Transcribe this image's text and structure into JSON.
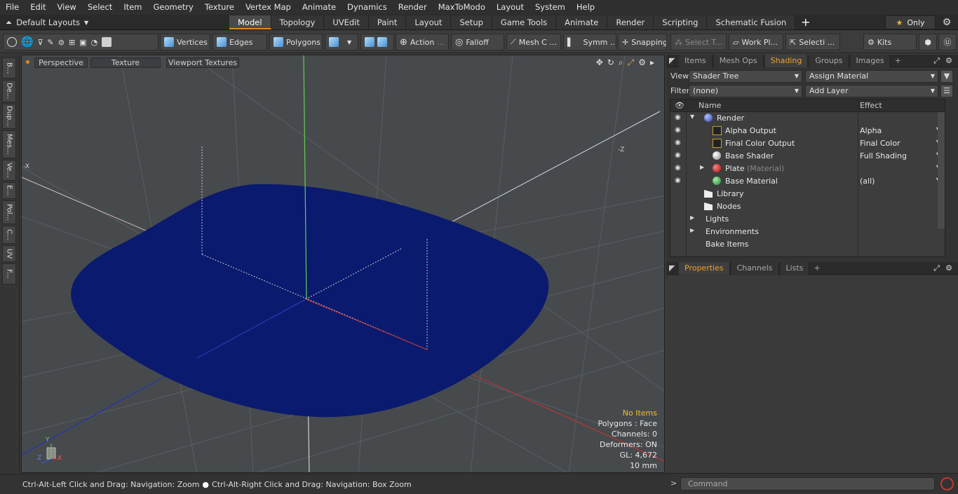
{
  "menu": [
    "File",
    "Edit",
    "View",
    "Select",
    "Item",
    "Geometry",
    "Texture",
    "Vertex Map",
    "Animate",
    "Dynamics",
    "Render",
    "MaxToModo",
    "Layout",
    "System",
    "Help"
  ],
  "layout_selector": "Default Layouts",
  "mode_tabs": [
    {
      "label": "Model",
      "active": true
    },
    {
      "label": "Topology"
    },
    {
      "label": "UVEdit"
    },
    {
      "label": "Paint"
    },
    {
      "label": "Layout"
    },
    {
      "label": "Setup"
    },
    {
      "label": "Game Tools"
    },
    {
      "label": "Animate"
    },
    {
      "label": "Render"
    },
    {
      "label": "Scripting"
    },
    {
      "label": "Schematic Fusion"
    }
  ],
  "only_label": "Only",
  "toolbar": {
    "vertices": "Vertices",
    "edges": "Edges",
    "polygons": "Polygons",
    "action": "Action",
    "falloff": "Falloff",
    "mesh": "Mesh C ...",
    "symm": "Symm ...",
    "snapping": "Snapping",
    "select_t": "Select T...",
    "work_pl": "Work Pl...",
    "selecti": "Selecti ...",
    "kits": "Kits"
  },
  "left_tabs": [
    "B...",
    "De...",
    "Dup...",
    "Mes...",
    "Ve...",
    "E...",
    "Pol...",
    "C...",
    "UV",
    "F..."
  ],
  "viewport": {
    "perspective": "Perspective",
    "texture": "Texture",
    "viewport_textures": "Viewport Textures",
    "axis_minus_z": "-Z",
    "axis_minus_x": "-X",
    "hud": [
      "No Items",
      "Polygons : Face",
      "Channels: 0",
      "Deformers: ON",
      "GL: 4,672",
      "10 mm"
    ],
    "colors": {
      "object": "#0a1a6e",
      "background": "#464a4d"
    }
  },
  "statusbar": {
    "left": "Ctrl-Alt-Left Click and Drag: Navigation: Zoom",
    "right": "Ctrl-Alt-Right Click and Drag: Navigation: Box Zoom"
  },
  "right_panel": {
    "tabs": [
      "Items",
      "Mesh Ops",
      "Shading",
      "Groups",
      "Images"
    ],
    "active_tab": "Shading",
    "view_label": "View",
    "view_value": "Shader Tree",
    "assign_material": "Assign Material",
    "filter_label": "Filter",
    "filter_value": "(none)",
    "add_layer": "Add Layer",
    "col_name": "Name",
    "col_effect": "Effect",
    "tree": [
      {
        "name": "Render",
        "effect": "",
        "indent": 0,
        "icon": "render-ball"
      },
      {
        "name": "Alpha Output",
        "effect": "Alpha",
        "indent": 1,
        "icon": "output"
      },
      {
        "name": "Final Color Output",
        "effect": "Final Color",
        "indent": 1,
        "icon": "output"
      },
      {
        "name": "Base Shader",
        "effect": "Full Shading",
        "indent": 1,
        "icon": "shader-ball"
      },
      {
        "name": "Plate",
        "sub": "(Material)",
        "effect": "",
        "indent": 1,
        "icon": "material-ball"
      },
      {
        "name": "Base Material",
        "effect": "(all)",
        "indent": 1,
        "icon": "material-ball"
      },
      {
        "name": "Library",
        "effect": "",
        "indent": 0,
        "icon": "folder"
      },
      {
        "name": "Nodes",
        "effect": "",
        "indent": 0,
        "icon": "folder"
      },
      {
        "name": "Lights",
        "effect": "",
        "indent": -1,
        "icon": "none"
      },
      {
        "name": "Environments",
        "effect": "",
        "indent": -1,
        "icon": "none"
      },
      {
        "name": "Bake Items",
        "effect": "",
        "indent": -1,
        "icon": "none"
      }
    ],
    "bottom_tabs": [
      "Properties",
      "Channels",
      "Lists"
    ],
    "command_placeholder": "Command"
  }
}
